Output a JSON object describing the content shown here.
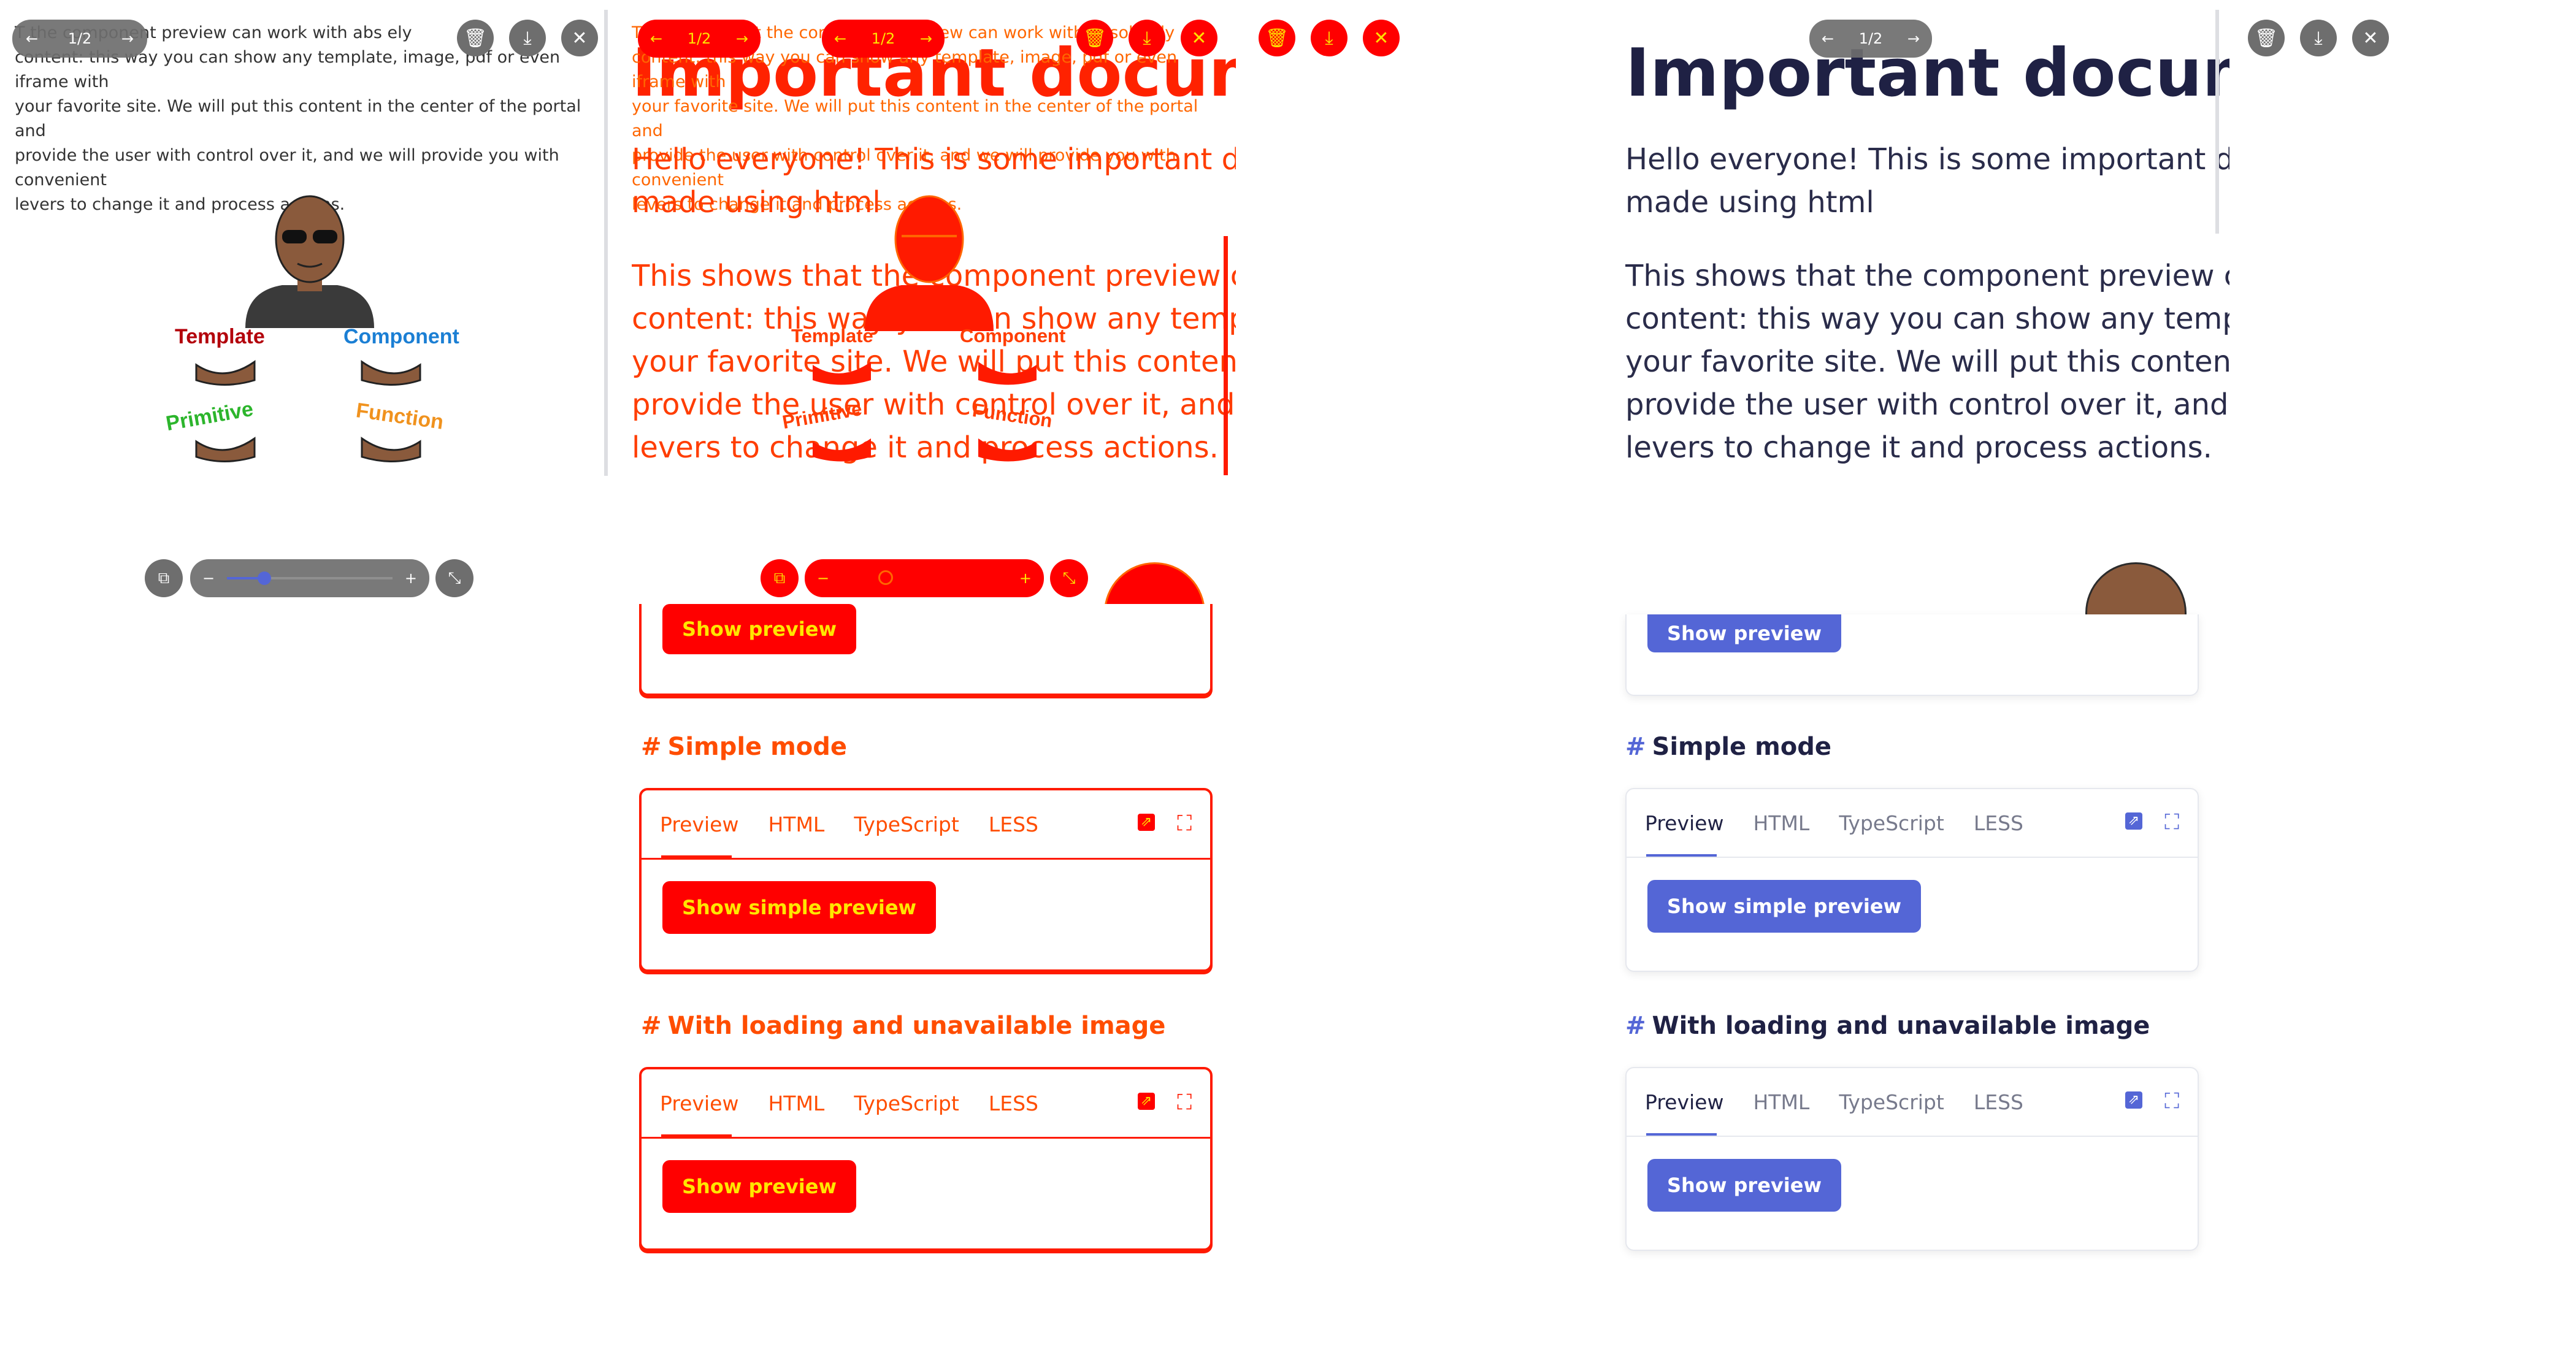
{
  "doc": {
    "title": "Important document",
    "p1": "Hello everyone! This is some important document made using html",
    "p1_line1": "Hello everyone! This is some important docu",
    "p1_line2": "made using html",
    "p2_lines": [
      "This shows that the component preview can",
      "content: this way you can show any template",
      "your favorite site. We will put this content in",
      "provide the user with control over it, and we",
      "levers to change it and process actions."
    ],
    "small_lines": [
      "This shows that the component preview can work with absolutely",
      "content: this way you can show any template, image, pdf or even iframe with",
      "your favorite site. We will put this content in the center of the portal and",
      "provide the user with control over it, and we will provide you with convenient",
      "levers to change it and process actions."
    ],
    "left_small_lines": [
      "T          the component preview can work with abs     ely",
      "content: this way you can show any template, image, pdf or even iframe with",
      "your favorite site. We will put this content in the center of the portal and",
      "provide the user with control over it, and we will provide you with convenient",
      "levers to change it and process actions."
    ]
  },
  "pager": {
    "label": "1/2"
  },
  "diagram": {
    "labels": [
      "Template",
      "Component",
      "Primitive",
      "Function"
    ],
    "colors": {
      "template": "#b3000b",
      "component": "#1b7fd4",
      "primitive": "#2cb52c",
      "function": "#f0921e"
    }
  },
  "icons": {
    "prev": "arrow-left-icon",
    "next": "arrow-right-icon",
    "delete": "trash-icon",
    "download": "download-icon",
    "close": "close-icon",
    "copy": "copy-icon",
    "zoom_out": "minus-icon",
    "zoom_in": "plus-icon",
    "collapse": "collapse-icon",
    "fullscreen": "fullscreen-icon",
    "external": "open-external-icon"
  },
  "cards": {
    "tabs": [
      "Preview",
      "HTML",
      "TypeScript",
      "LESS"
    ],
    "basic_button": "Show preview",
    "simple_heading": "Simple mode",
    "simple_button": "Show simple preview",
    "loading_heading": "With loading and unavailable image",
    "loading_button": "Show preview",
    "hash": "#"
  },
  "colors": {
    "accent": "#5466d6",
    "title": "#1f2144",
    "overlay_red": "#ff0000",
    "overlay_yellow": "#ffe600",
    "overlay_orange": "#ff6600"
  }
}
